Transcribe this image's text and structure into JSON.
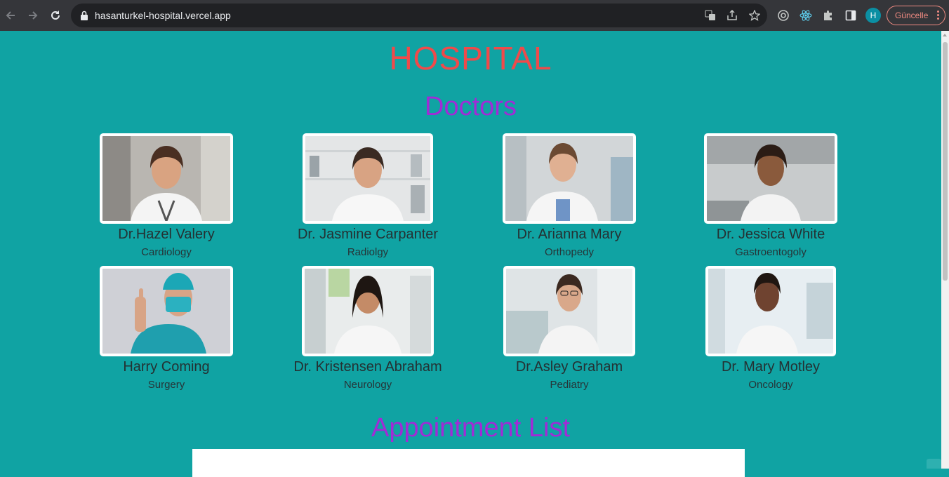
{
  "browser": {
    "url": "hasanturkel-hospital.vercel.app",
    "profile_initial": "H",
    "update_label": "Güncelle",
    "icons": [
      "back-arrow-icon",
      "forward-arrow-icon",
      "reload-icon",
      "lock-icon",
      "translate-icon",
      "share-icon",
      "star-icon",
      "extension-circle-icon",
      "react-devtools-icon",
      "puzzle-icon",
      "side-panel-icon",
      "kebab-menu-icon"
    ]
  },
  "page": {
    "title": "HOSPITAL",
    "doctors_heading": "Doctors",
    "appointments_heading": "Appointment List",
    "colors": {
      "background": "#10a3a3",
      "title": "#f04a4a",
      "heading": "#a12bd6"
    }
  },
  "doctors": [
    {
      "name": "Dr.Hazel Valery",
      "department": "Cardiology"
    },
    {
      "name": "Dr. Jasmine Carpanter",
      "department": "Radiolgy"
    },
    {
      "name": "Dr. Arianna Mary",
      "department": "Orthopedy"
    },
    {
      "name": "Dr. Jessica White",
      "department": "Gastroentogoly"
    },
    {
      "name": "Harry Coming",
      "department": "Surgery"
    },
    {
      "name": "Dr. Kristensen Abraham",
      "department": "Neurology"
    },
    {
      "name": "Dr.Asley Graham",
      "department": "Pediatry"
    },
    {
      "name": "Dr. Mary Motley",
      "department": "Oncology"
    }
  ]
}
